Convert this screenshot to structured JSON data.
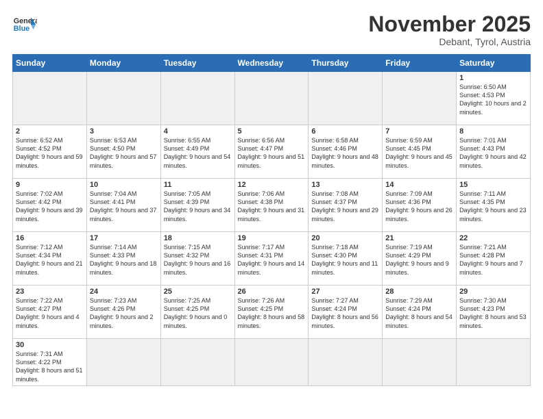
{
  "header": {
    "logo_general": "General",
    "logo_blue": "Blue",
    "month_title": "November 2025",
    "location": "Debant, Tyrol, Austria"
  },
  "weekdays": [
    "Sunday",
    "Monday",
    "Tuesday",
    "Wednesday",
    "Thursday",
    "Friday",
    "Saturday"
  ],
  "weeks": [
    [
      {
        "day": "",
        "info": ""
      },
      {
        "day": "",
        "info": ""
      },
      {
        "day": "",
        "info": ""
      },
      {
        "day": "",
        "info": ""
      },
      {
        "day": "",
        "info": ""
      },
      {
        "day": "",
        "info": ""
      },
      {
        "day": "1",
        "info": "Sunrise: 6:50 AM\nSunset: 4:53 PM\nDaylight: 10 hours\nand 2 minutes."
      }
    ],
    [
      {
        "day": "2",
        "info": "Sunrise: 6:52 AM\nSunset: 4:52 PM\nDaylight: 9 hours\nand 59 minutes."
      },
      {
        "day": "3",
        "info": "Sunrise: 6:53 AM\nSunset: 4:50 PM\nDaylight: 9 hours\nand 57 minutes."
      },
      {
        "day": "4",
        "info": "Sunrise: 6:55 AM\nSunset: 4:49 PM\nDaylight: 9 hours\nand 54 minutes."
      },
      {
        "day": "5",
        "info": "Sunrise: 6:56 AM\nSunset: 4:47 PM\nDaylight: 9 hours\nand 51 minutes."
      },
      {
        "day": "6",
        "info": "Sunrise: 6:58 AM\nSunset: 4:46 PM\nDaylight: 9 hours\nand 48 minutes."
      },
      {
        "day": "7",
        "info": "Sunrise: 6:59 AM\nSunset: 4:45 PM\nDaylight: 9 hours\nand 45 minutes."
      },
      {
        "day": "8",
        "info": "Sunrise: 7:01 AM\nSunset: 4:43 PM\nDaylight: 9 hours\nand 42 minutes."
      }
    ],
    [
      {
        "day": "9",
        "info": "Sunrise: 7:02 AM\nSunset: 4:42 PM\nDaylight: 9 hours\nand 39 minutes."
      },
      {
        "day": "10",
        "info": "Sunrise: 7:04 AM\nSunset: 4:41 PM\nDaylight: 9 hours\nand 37 minutes."
      },
      {
        "day": "11",
        "info": "Sunrise: 7:05 AM\nSunset: 4:39 PM\nDaylight: 9 hours\nand 34 minutes."
      },
      {
        "day": "12",
        "info": "Sunrise: 7:06 AM\nSunset: 4:38 PM\nDaylight: 9 hours\nand 31 minutes."
      },
      {
        "day": "13",
        "info": "Sunrise: 7:08 AM\nSunset: 4:37 PM\nDaylight: 9 hours\nand 29 minutes."
      },
      {
        "day": "14",
        "info": "Sunrise: 7:09 AM\nSunset: 4:36 PM\nDaylight: 9 hours\nand 26 minutes."
      },
      {
        "day": "15",
        "info": "Sunrise: 7:11 AM\nSunset: 4:35 PM\nDaylight: 9 hours\nand 23 minutes."
      }
    ],
    [
      {
        "day": "16",
        "info": "Sunrise: 7:12 AM\nSunset: 4:34 PM\nDaylight: 9 hours\nand 21 minutes."
      },
      {
        "day": "17",
        "info": "Sunrise: 7:14 AM\nSunset: 4:33 PM\nDaylight: 9 hours\nand 18 minutes."
      },
      {
        "day": "18",
        "info": "Sunrise: 7:15 AM\nSunset: 4:32 PM\nDaylight: 9 hours\nand 16 minutes."
      },
      {
        "day": "19",
        "info": "Sunrise: 7:17 AM\nSunset: 4:31 PM\nDaylight: 9 hours\nand 14 minutes."
      },
      {
        "day": "20",
        "info": "Sunrise: 7:18 AM\nSunset: 4:30 PM\nDaylight: 9 hours\nand 11 minutes."
      },
      {
        "day": "21",
        "info": "Sunrise: 7:19 AM\nSunset: 4:29 PM\nDaylight: 9 hours\nand 9 minutes."
      },
      {
        "day": "22",
        "info": "Sunrise: 7:21 AM\nSunset: 4:28 PM\nDaylight: 9 hours\nand 7 minutes."
      }
    ],
    [
      {
        "day": "23",
        "info": "Sunrise: 7:22 AM\nSunset: 4:27 PM\nDaylight: 9 hours\nand 4 minutes."
      },
      {
        "day": "24",
        "info": "Sunrise: 7:23 AM\nSunset: 4:26 PM\nDaylight: 9 hours\nand 2 minutes."
      },
      {
        "day": "25",
        "info": "Sunrise: 7:25 AM\nSunset: 4:25 PM\nDaylight: 9 hours\nand 0 minutes."
      },
      {
        "day": "26",
        "info": "Sunrise: 7:26 AM\nSunset: 4:25 PM\nDaylight: 8 hours\nand 58 minutes."
      },
      {
        "day": "27",
        "info": "Sunrise: 7:27 AM\nSunset: 4:24 PM\nDaylight: 8 hours\nand 56 minutes."
      },
      {
        "day": "28",
        "info": "Sunrise: 7:29 AM\nSunset: 4:24 PM\nDaylight: 8 hours\nand 54 minutes."
      },
      {
        "day": "29",
        "info": "Sunrise: 7:30 AM\nSunset: 4:23 PM\nDaylight: 8 hours\nand 53 minutes."
      }
    ],
    [
      {
        "day": "30",
        "info": "Sunrise: 7:31 AM\nSunset: 4:22 PM\nDaylight: 8 hours\nand 51 minutes."
      },
      {
        "day": "",
        "info": ""
      },
      {
        "day": "",
        "info": ""
      },
      {
        "day": "",
        "info": ""
      },
      {
        "day": "",
        "info": ""
      },
      {
        "day": "",
        "info": ""
      },
      {
        "day": "",
        "info": ""
      }
    ]
  ]
}
